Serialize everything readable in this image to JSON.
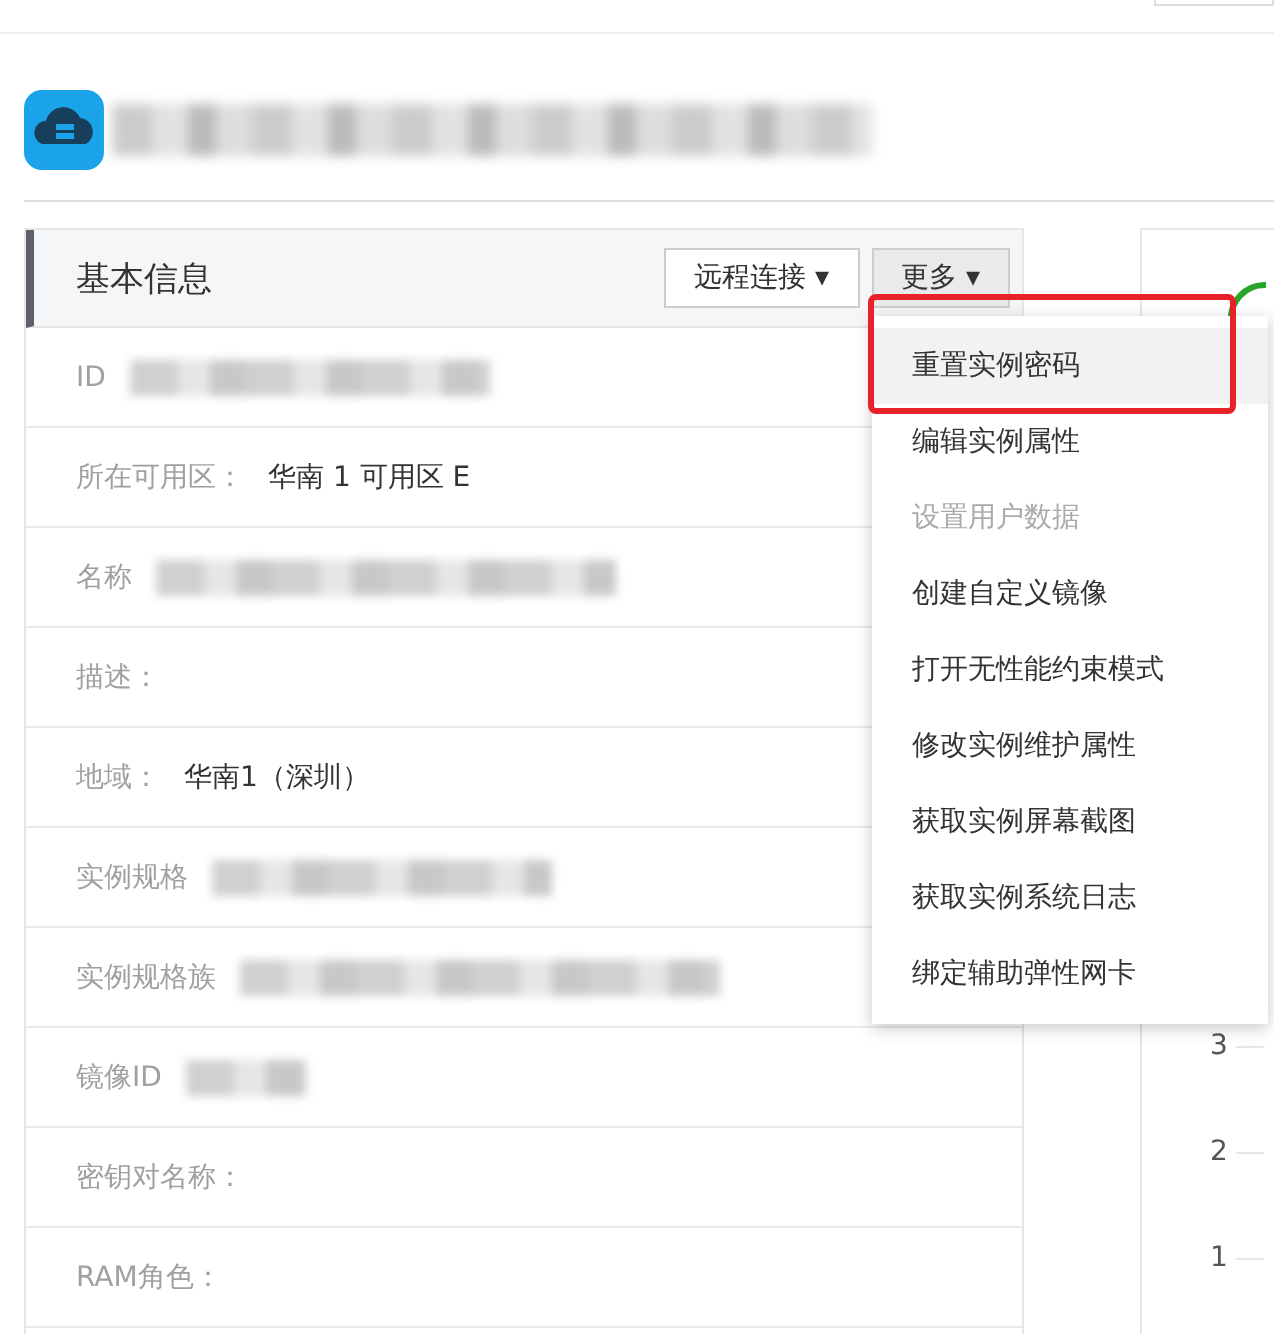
{
  "header": {
    "title_redacted": true
  },
  "info_panel": {
    "title": "基本信息",
    "buttons": [
      {
        "label": "远程连接",
        "caret": "▾"
      },
      {
        "label": "更多",
        "caret": "▾"
      }
    ],
    "rows": [
      {
        "label": "ID",
        "kind": "blurred"
      },
      {
        "label": "所在可用区：",
        "kind": "text",
        "value": "华南 1 可用区 E"
      },
      {
        "label": "名称",
        "kind": "blurred"
      },
      {
        "label": "描述：",
        "kind": "empty"
      },
      {
        "label": "地域：",
        "kind": "text",
        "value": "华南1（深圳）"
      },
      {
        "label": "实例规格",
        "kind": "blurred"
      },
      {
        "label": "实例规格族",
        "kind": "blurred"
      },
      {
        "label": "镜像ID",
        "kind": "blurred"
      },
      {
        "label": "密钥对名称：",
        "kind": "empty"
      },
      {
        "label": "RAM角色：",
        "kind": "empty"
      }
    ]
  },
  "dropdown_menu": {
    "items": [
      {
        "label": "重置实例密码",
        "selected": true,
        "disabled": false,
        "annotated": true
      },
      {
        "label": "编辑实例属性",
        "selected": false,
        "disabled": false,
        "annotated": false
      },
      {
        "label": "设置用户数据",
        "selected": false,
        "disabled": true,
        "annotated": false
      },
      {
        "label": "创建自定义镜像",
        "selected": false,
        "disabled": false,
        "annotated": false
      },
      {
        "label": "打开无性能约束模式",
        "selected": false,
        "disabled": false,
        "annotated": false
      },
      {
        "label": "修改实例维护属性",
        "selected": false,
        "disabled": false,
        "annotated": false
      },
      {
        "label": "获取实例屏幕截图",
        "selected": false,
        "disabled": false,
        "annotated": false
      },
      {
        "label": "获取实例系统日志",
        "selected": false,
        "disabled": false,
        "annotated": false
      },
      {
        "label": "绑定辅助弹性网卡",
        "selected": false,
        "disabled": false,
        "annotated": false
      }
    ]
  },
  "side_panel": {
    "axis_ticks": [
      "3",
      "2",
      "1"
    ]
  }
}
